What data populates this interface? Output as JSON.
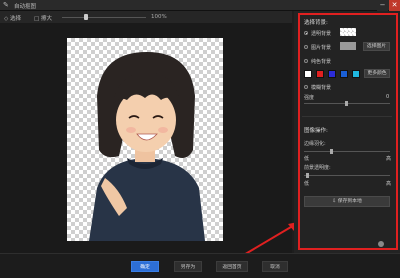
{
  "window": {
    "title": "自动抠图",
    "minimize_label": "−",
    "close_label": "✕"
  },
  "toolbar": {
    "select_label": "◇ 选择",
    "erase_label": "□ 擦大",
    "zoom_value": "100%"
  },
  "panel": {
    "heading_bg": "选择背景:",
    "opt_transparent": "透明背景",
    "opt_image": "图片背景",
    "select_image_button": "选择图片",
    "opt_pure": "纯色背景",
    "more_colors_button": "更多颜色",
    "opt_blur": "模糊背景",
    "blur_label": "强度",
    "blur_value": "0",
    "heading_effects": "图像操作:",
    "edge_label": "边缘羽化:",
    "edge_min": "低",
    "edge_max": "高",
    "smooth_label": "前景透明度:",
    "smooth_min": "低",
    "smooth_max": "高",
    "save_button": "保存到本地",
    "swatch_colors": [
      "#ffffff",
      "#e02020",
      "#2c2cd8",
      "#1a5fd6",
      "#20b8e0",
      "#000000"
    ]
  },
  "bottom": {
    "ok": "确定",
    "save_as": "另存为",
    "back": "返回首页",
    "cancel": "取消"
  }
}
